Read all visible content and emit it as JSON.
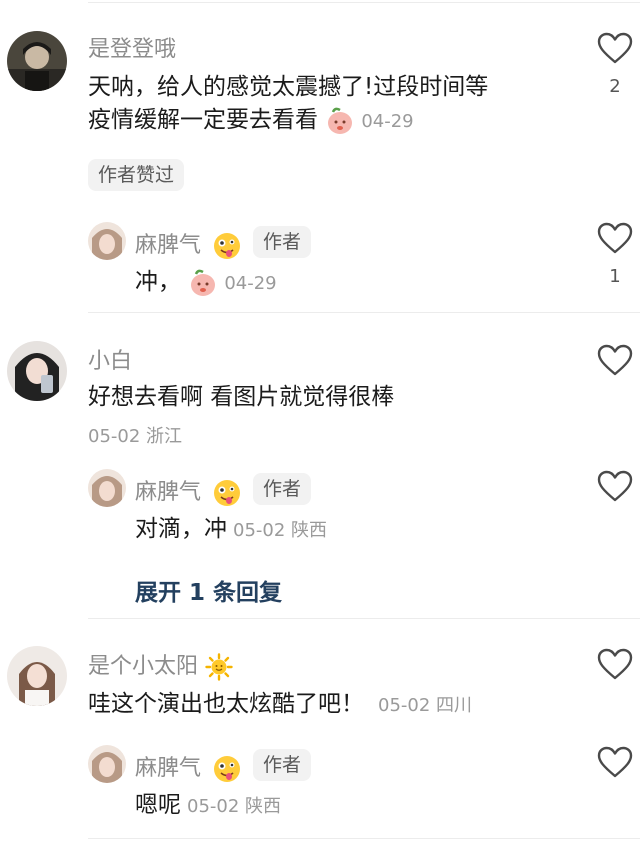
{
  "comments": [
    {
      "user": "是登登哦",
      "text_line1": "天呐，给人的感觉太震撼了!过段时间等",
      "text_line2": "疫情缓解一定要去看看",
      "date": "04-29",
      "author_liked": "作者赞过",
      "like_count": "2",
      "reply": {
        "user": "麻脾气",
        "badge": "作者",
        "text": "冲，",
        "date": "04-29",
        "like_count": "1"
      }
    },
    {
      "user": "小白",
      "text": "好想去看啊 看图片就觉得很棒",
      "meta": "05-02 浙江",
      "reply": {
        "user": "麻脾气",
        "badge": "作者",
        "text": "对滴，冲",
        "meta": "05-02 陕西"
      },
      "expand": "展开 1 条回复"
    },
    {
      "user": "是个小太阳",
      "text": "哇这个演出也太炫酷了吧！",
      "meta": "05-02 四川",
      "reply": {
        "user": "麻脾气",
        "badge": "作者",
        "text": "嗯呢",
        "meta": "05-02 陕西"
      }
    }
  ],
  "icons": {
    "like": "heart-outline-icon",
    "peach_emoji": "peach-emoji-icon",
    "tongue_emoji": "tongue-face-emoji-icon",
    "sun_emoji": "sun-emoji-icon"
  },
  "colors": {
    "username": "#8c8c8c",
    "text": "#1b1b1b",
    "meta": "#9a9a9a",
    "expand": "#23405f",
    "badge_bg": "#f2f2f2"
  }
}
